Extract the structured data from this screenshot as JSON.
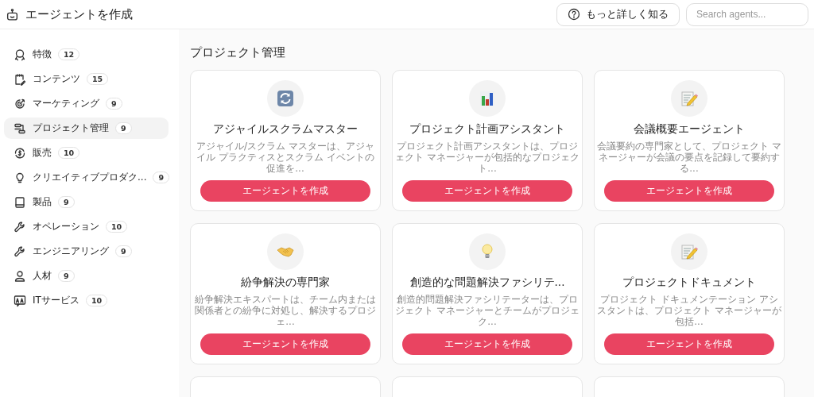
{
  "header": {
    "title": "エージェントを作成",
    "learn_more": "もっと詳しく知る",
    "search": {
      "placeholder": "Search agents..."
    }
  },
  "sidebar": {
    "items": [
      {
        "kind": "award",
        "label": "特徴",
        "count": "12",
        "selected": false
      },
      {
        "kind": "clipboard",
        "label": "コンテンツ",
        "count": "15",
        "selected": false
      },
      {
        "kind": "target",
        "label": "マーケティング",
        "count": "9",
        "selected": false
      },
      {
        "kind": "flow",
        "label": "プロジェクト管理",
        "count": "9",
        "selected": true
      },
      {
        "kind": "dollar",
        "label": "販売",
        "count": "10",
        "selected": false
      },
      {
        "kind": "bulb",
        "label": "クリエイティブプロダク...",
        "count": "9",
        "selected": false
      },
      {
        "kind": "book",
        "label": "製品",
        "count": "9",
        "selected": false
      },
      {
        "kind": "wrench",
        "label": "オペレーション",
        "count": "10",
        "selected": false
      },
      {
        "kind": "wrench",
        "label": "エンジニアリング",
        "count": "9",
        "selected": false
      },
      {
        "kind": "person",
        "label": "人材",
        "count": "9",
        "selected": false
      },
      {
        "kind": "translate",
        "label": "ITサービス",
        "count": "10",
        "selected": false
      }
    ]
  },
  "section": {
    "title": "プロジェクト管理"
  },
  "cards": [
    {
      "kind": "sync",
      "title": "アジャイルスクラムマスター",
      "description": "アジャイル/スクラム マスターは、アジャイル プラクティスとスクラム イベントの促進を...",
      "button": "エージェントを作成"
    },
    {
      "kind": "chart",
      "title": "プロジェクト計画アシスタント",
      "description": "プロジェクト計画アシスタントは、プロジェクト マネージャーが包括的なプロジェクト...",
      "button": "エージェントを作成"
    },
    {
      "kind": "memo",
      "title": "会議概要エージェント",
      "description": "会議要約の専門家として、プロジェクト マネージャーが会議の要点を記録して要約する...",
      "button": "エージェントを作成"
    },
    {
      "kind": "handshake",
      "title": "紛争解決の専門家",
      "description": "紛争解決エキスパートは、チーム内または関係者との紛争に対処し、解決するプロジェ...",
      "button": "エージェントを作成"
    },
    {
      "kind": "bulb",
      "title": "創造的な問題解決ファシリテ...",
      "description": "創造的問題解決ファシリテーターは、プロジェクト マネージャーとチームがプロジェク...",
      "button": "エージェントを作成"
    },
    {
      "kind": "memo",
      "title": "プロジェクトドキュメント",
      "description": "プロジェクト ドキュメンテーション アシスタントは、プロジェクト マネージャーが包括...",
      "button": "エージェントを作成"
    },
    {
      "kind": "cut-off"
    },
    {
      "kind": "cut-off"
    },
    {
      "kind": "cut-off"
    }
  ]
}
